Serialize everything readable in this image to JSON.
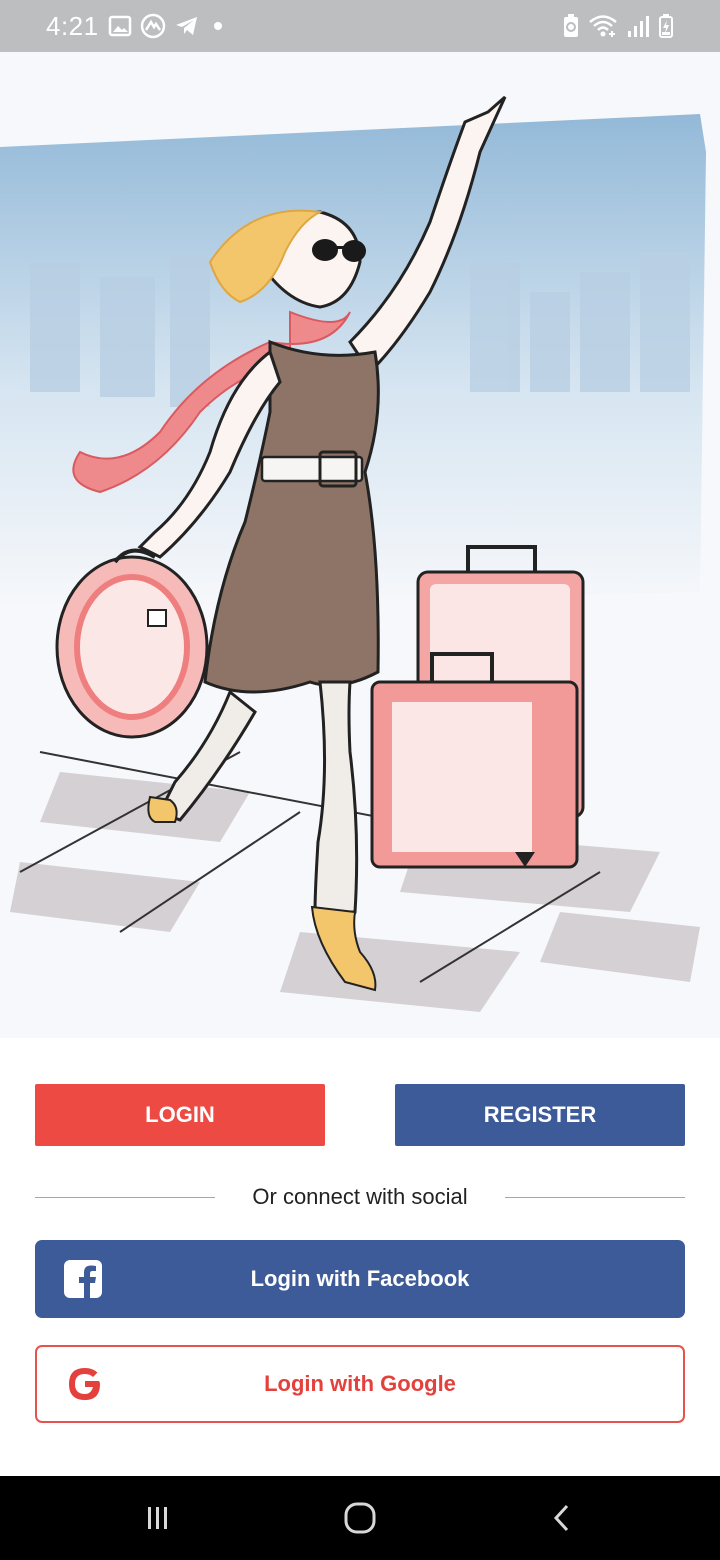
{
  "status_bar": {
    "time": "4:21",
    "left_icons": [
      "gallery-icon",
      "app-icon",
      "telegram-icon",
      "dot"
    ],
    "right_icons": [
      "battery-saver-icon",
      "wifi-icon",
      "signal-icon",
      "battery-charging-icon"
    ]
  },
  "hero": {
    "illustration": "woman-with-luggage-waving"
  },
  "auth": {
    "login_label": "LOGIN",
    "register_label": "REGISTER",
    "divider_text": "Or connect with social",
    "facebook_label": "Login with Facebook",
    "google_label": "Login with Google"
  },
  "nav": {
    "recents": "recents-icon",
    "home": "home-icon",
    "back": "back-icon"
  },
  "colors": {
    "login": "#ed4a43",
    "register": "#3d5a99",
    "facebook": "#3d5a99",
    "google": "#e4413c",
    "status_bar": "#bdbebf",
    "nav_bar": "#000000"
  }
}
